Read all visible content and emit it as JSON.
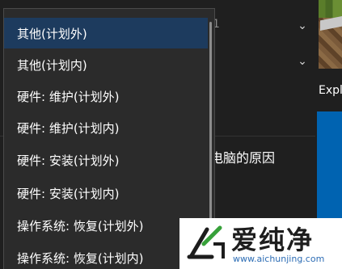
{
  "dropdown": {
    "items": [
      {
        "label": "其他(计划外)",
        "selected": true
      },
      {
        "label": "其他(计划内)",
        "selected": false
      },
      {
        "label": "硬件: 维护(计划外)",
        "selected": false
      },
      {
        "label": "硬件: 维护(计划内)",
        "selected": false
      },
      {
        "label": "硬件: 安装(计划外)",
        "selected": false
      },
      {
        "label": "硬件: 安装(计划内)",
        "selected": false
      },
      {
        "label": "操作系统: 恢复(计划外)",
        "selected": false
      },
      {
        "label": "操作系统: 恢复(计划内)",
        "selected": false
      }
    ]
  },
  "background": {
    "combo_chevron": "⌄",
    "combo_tail_text": "1",
    "reason_label": "电脑的原因",
    "right_panel_text": "Expl"
  },
  "watermark": {
    "brand": "爱纯净",
    "url": "www.aichunjing.com"
  },
  "colors": {
    "selected_bg": "#1d3b5e",
    "menu_bg": "#2b2b2b",
    "accent_blue": "#0063b1"
  }
}
